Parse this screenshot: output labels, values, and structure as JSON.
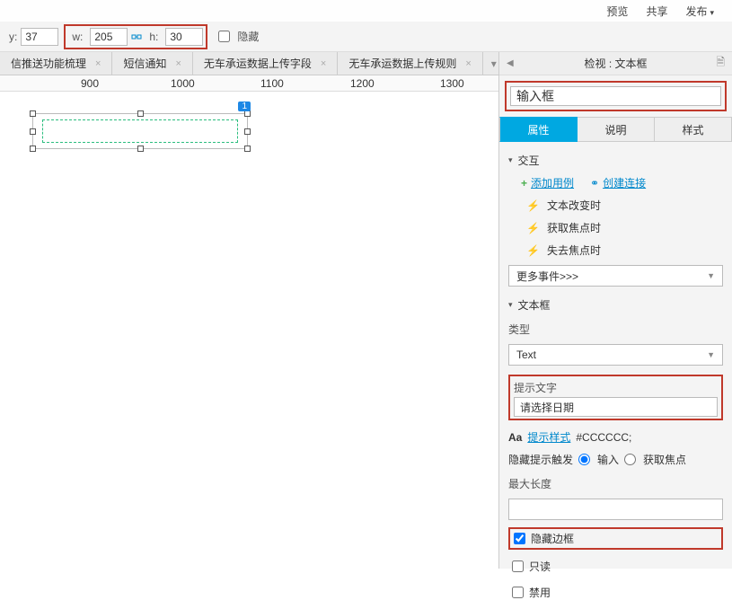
{
  "top_menu": {
    "preview": "预览",
    "share": "共享",
    "publish": "发布"
  },
  "toolbar": {
    "y_label": "y:",
    "y_val": "37",
    "w_label": "w:",
    "w_val": "205",
    "h_label": "h:",
    "h_val": "30",
    "hide_label": "隐藏"
  },
  "tabs": [
    "信推送功能梳理",
    "短信通知",
    "无车承运数据上传字段",
    "无车承运数据上传规则"
  ],
  "ruler_ticks": [
    {
      "pos": 90,
      "label": "900"
    },
    {
      "pos": 190,
      "label": "1000"
    },
    {
      "pos": 290,
      "label": "1100"
    },
    {
      "pos": 390,
      "label": "1200"
    },
    {
      "pos": 490,
      "label": "1300"
    }
  ],
  "canvas": {
    "badge": "1"
  },
  "inspector": {
    "title": "检视 : 文本框",
    "name": "输入框",
    "tabs": {
      "prop": "属性",
      "note": "说明",
      "style": "样式"
    },
    "interaction": {
      "header": "交互",
      "add_case": "添加用例",
      "create_link": "创建连接",
      "events": [
        "文本改变时",
        "获取焦点时",
        "失去焦点时"
      ],
      "more": "更多事件>>>"
    },
    "textbox": {
      "header": "文本框",
      "type_label": "类型",
      "type_value": "Text",
      "hint_label": "提示文字",
      "hint_value": "请选择日期",
      "hint_style": "提示样式",
      "hint_color": "#CCCCCC;",
      "hide_hint_trigger": "隐藏提示触发",
      "radio_input": "输入",
      "radio_focus": "获取焦点",
      "max_len": "最大长度",
      "hide_border": "隐藏边框",
      "readonly": "只读",
      "disabled": "禁用"
    }
  }
}
